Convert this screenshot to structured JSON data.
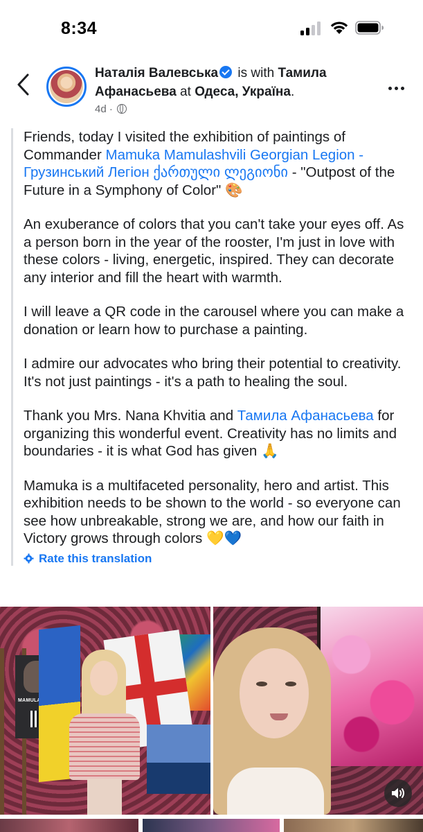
{
  "status_bar": {
    "time": "8:34"
  },
  "header": {
    "author": "Наталія Валевська",
    "with_text": " is with ",
    "tagged": "Тамила Афанасьева",
    "at_text": " at ",
    "location": "Одеса, Україна",
    "period": ".",
    "timestamp": "4d",
    "dot": " · "
  },
  "post": {
    "p1_a": "Friends, today I visited the exhibition of paintings of Commander ",
    "p1_link": "Mamuka Mamulashvili Georgian Legion - Грузинський Легіон ქართული ლეგიონი",
    "p1_b": " - \"Outpost of the Future in a Symphony of Color\" 🎨",
    "p2": "An exuberance of colors that you can't take your eyes off. As a person born in the year of the rooster, I'm just in love with these colors - living, energetic, inspired. They can decorate any interior and fill the heart with warmth.",
    "p3": "I will leave a QR code in the carousel where you can make a donation or learn how to purchase a painting.",
    "p4": "I admire our advocates who bring their potential to creativity. It's not just paintings - it's a path to healing the soul.",
    "p5_a": "Thank you Mrs. Nana Khvitia and ",
    "p5_link": "Тамила Афанасьева",
    "p5_b": " for organizing this wonderful event. Creativity has no limits and boundaries - it is what God has given 🙏",
    "p6": "Mamuka is a multifaceted personality, hero and artist. This exhibition needs to be shown to the world - so everyone can see how unbreakable, strong we are, and how our faith in Victory grows through colors 💛💙",
    "rate_translation": "Rate this translation"
  },
  "photo1_poster_text": "MAMULASHVILI",
  "colors": {
    "accent": "#1877f2",
    "text": "#1c1e21",
    "muted": "#65676b"
  }
}
